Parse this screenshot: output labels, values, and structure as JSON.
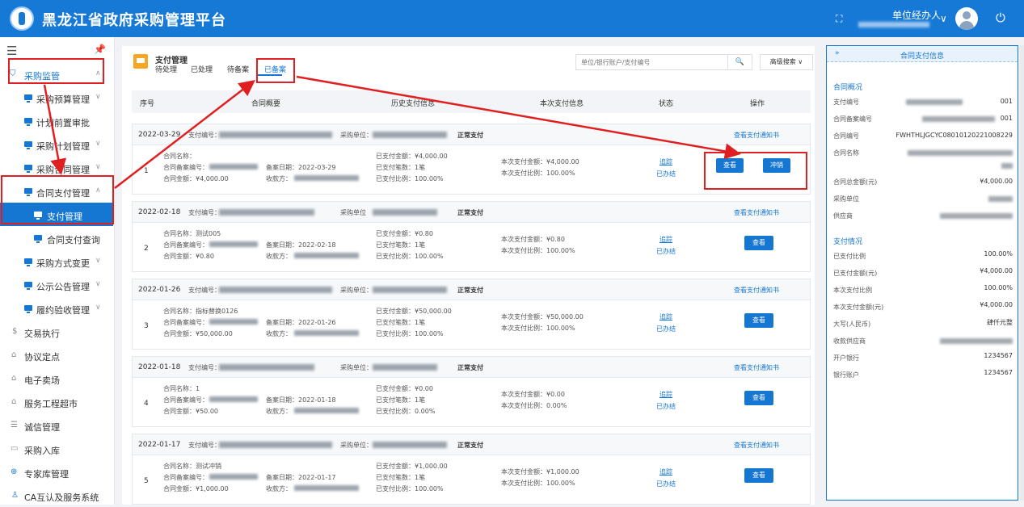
{
  "header": {
    "title": "黑龙江省政府采购管理平台",
    "user_role": "单位经办人",
    "fullscreen_icon": "⛶",
    "power_icon": "⏻"
  },
  "sidebar": {
    "items": [
      {
        "label": "采购监管",
        "icon": "shield-icon",
        "expanded": true
      },
      {
        "label": "采购预算管理"
      },
      {
        "label": "计划前置审批"
      },
      {
        "label": "采购计划管理"
      },
      {
        "label": "采购合同管理"
      },
      {
        "label": "合同支付管理",
        "expanded": true
      },
      {
        "label": "支付管理",
        "active": true
      },
      {
        "label": "合同支付查询"
      },
      {
        "label": "采购方式变更"
      },
      {
        "label": "公示公告管理"
      },
      {
        "label": "履约验收管理"
      },
      {
        "label": "交易执行"
      },
      {
        "label": "协议定点"
      },
      {
        "label": "电子卖场"
      },
      {
        "label": "服务工程超市"
      },
      {
        "label": "诚信管理"
      },
      {
        "label": "采购入库"
      },
      {
        "label": "专家库管理"
      },
      {
        "label": "CA互认及服务系统"
      }
    ]
  },
  "main": {
    "title": "支付管理",
    "tabs": [
      "待处理",
      "已处理",
      "待备案",
      "已备案"
    ],
    "active_tab": "已备案",
    "search_placeholder": "单位/银行账户/支付编号",
    "search_icon": "🔍",
    "adv_search": "高级搜索 ∨",
    "columns": [
      "序号",
      "合同概要",
      "历史支付信息",
      "本次支付信息",
      "状态",
      "操作"
    ]
  },
  "labels": {
    "pay_no": "支付编号：",
    "unit": "采购单位：",
    "unit_plain": "采购单位",
    "status": "正常支付",
    "notice": "查看支付通知书",
    "contract_name": "合同名称：",
    "filing_no": "合同备案编号：",
    "filing_date": "备案日期：",
    "contract_amount": "合同金额：",
    "payee": "收款方：",
    "paid_amount": "已支付金额：",
    "paid_count": "已支付笔数：",
    "paid_ratio": "已支付比例：",
    "cur_amount": "本次支付金额：",
    "cur_ratio": "本次支付比例：",
    "track": "追踪",
    "done": "已办结",
    "view": "查看",
    "reverse": "冲销"
  },
  "records": [
    {
      "idx": "1",
      "date": "2022-03-29",
      "unit_label": "采购单位：",
      "contract_name": "",
      "filing_date": "2022-03-29",
      "contract_amount": "¥4,000.00",
      "paid_amount": "¥4,000.00",
      "paid_count": "1笔",
      "paid_ratio": "100.00%",
      "cur_amount": "¥4,000.00",
      "cur_ratio": "100.00%",
      "has_reverse": true
    },
    {
      "idx": "2",
      "date": "2022-02-18",
      "unit_label": "采购单位",
      "contract_name": "测试005",
      "filing_date": "2022-02-18",
      "contract_amount": "¥0.80",
      "paid_amount": "¥0.80",
      "paid_count": "1笔",
      "paid_ratio": "100.00%",
      "cur_amount": "¥0.80",
      "cur_ratio": "100.00%",
      "has_reverse": false
    },
    {
      "idx": "3",
      "date": "2022-01-26",
      "unit_label": "采购单位：",
      "contract_name": "指标替换0126",
      "filing_date": "2022-01-26",
      "contract_amount": "¥50,000.00",
      "paid_amount": "¥50,000.00",
      "paid_count": "1笔",
      "paid_ratio": "100.00%",
      "cur_amount": "¥50,000.00",
      "cur_ratio": "100.00%",
      "has_reverse": false
    },
    {
      "idx": "4",
      "date": "2022-01-18",
      "unit_label": "采购单位：",
      "contract_name": "1",
      "filing_date": "2022-01-18",
      "contract_amount": "¥50.00",
      "paid_amount": "¥0.00",
      "paid_count": "1笔",
      "paid_ratio": "0.00%",
      "cur_amount": "¥0.00",
      "cur_ratio": "0.00%",
      "has_reverse": false
    },
    {
      "idx": "5",
      "date": "2022-01-17",
      "unit_label": "采购单位：",
      "contract_name": "测试冲销",
      "filing_date": "2022-01-17",
      "contract_amount": "¥1,000.00",
      "paid_amount": "¥1,000.00",
      "paid_count": "1笔",
      "paid_ratio": "100.00%",
      "cur_amount": "¥1,000.00",
      "cur_ratio": "100.00%",
      "has_reverse": false
    }
  ],
  "right_panel": {
    "title": "合同支付信息",
    "expand_icon": "»",
    "overview_title": "合同概况",
    "overview": [
      {
        "label": "支付编号",
        "value": "001"
      },
      {
        "label": "合同备案编号",
        "value": "001"
      },
      {
        "label": "合同编号",
        "value": "FWHTHLJGCYC08010120221008229"
      },
      {
        "label": "合同名称",
        "value": ""
      },
      {
        "label": "合同总金额(元)",
        "value": "¥4,000.00"
      },
      {
        "label": "采购单位",
        "value": ""
      },
      {
        "label": "供应商",
        "value": ""
      }
    ],
    "payment_title": "支付情况",
    "payment": [
      {
        "label": "已支付比例",
        "value": "100.00%"
      },
      {
        "label": "已支付金额(元)",
        "value": "¥4,000.00"
      },
      {
        "label": "本次支付比例",
        "value": "100.00%"
      },
      {
        "label": "本次支付金额(元)",
        "value": "¥4,000.00"
      },
      {
        "label": "大写(人民币)",
        "value": "肆仟元整"
      },
      {
        "label": "收款供应商",
        "value": ""
      },
      {
        "label": "开户银行",
        "value": "1234567"
      },
      {
        "label": "银行账户",
        "value": "1234567"
      }
    ]
  }
}
